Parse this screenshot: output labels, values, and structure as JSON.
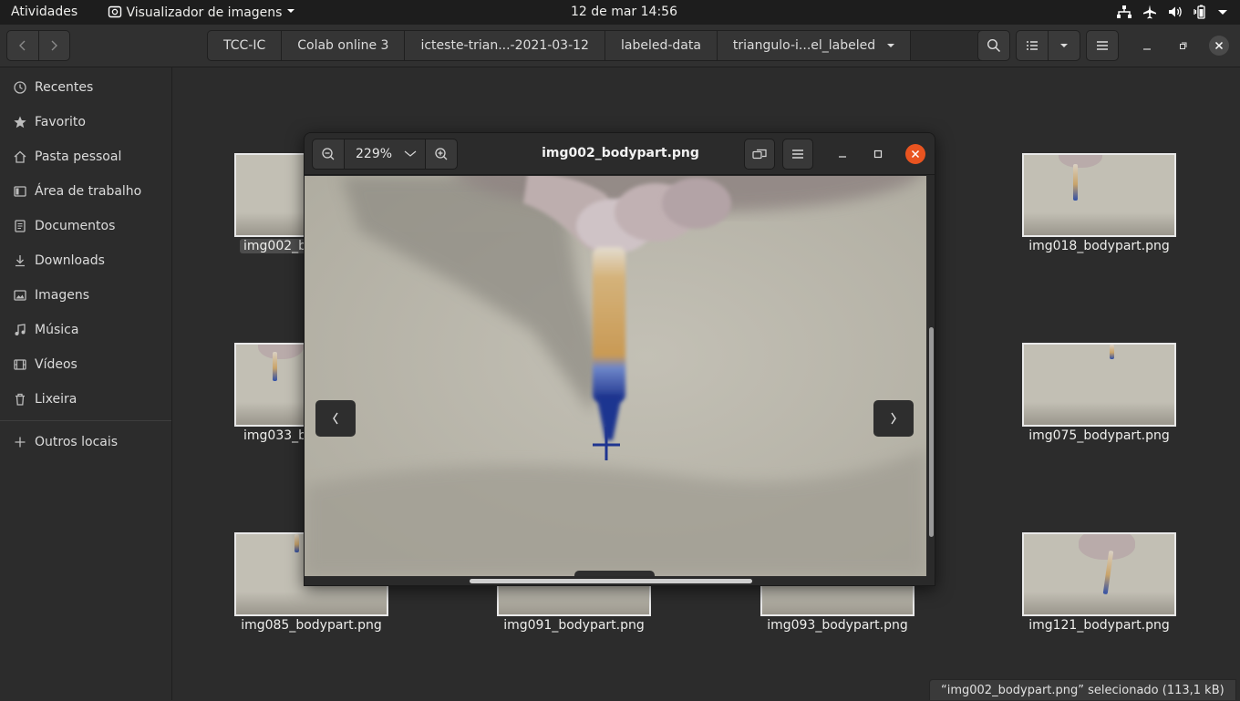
{
  "topbar": {
    "activities": "Atividades",
    "app_name": "Visualizador de imagens",
    "clock": "12 de mar  14:56"
  },
  "header": {
    "breadcrumbs": [
      "TCC-IC",
      "Colab online 3",
      "icteste-trian...-2021-03-12",
      "labeled-data",
      "triangulo-i...el_labeled"
    ]
  },
  "sidebar": {
    "items": [
      {
        "label": "Recentes",
        "icon": "clock-icon"
      },
      {
        "label": "Favorito",
        "icon": "star-icon"
      },
      {
        "label": "Pasta pessoal",
        "icon": "home-icon"
      },
      {
        "label": "Área de trabalho",
        "icon": "desktop-icon"
      },
      {
        "label": "Documentos",
        "icon": "document-icon"
      },
      {
        "label": "Downloads",
        "icon": "download-icon"
      },
      {
        "label": "Imagens",
        "icon": "image-icon"
      },
      {
        "label": "Música",
        "icon": "music-icon"
      },
      {
        "label": "Vídeos",
        "icon": "video-icon"
      },
      {
        "label": "Lixeira",
        "icon": "trash-icon"
      }
    ],
    "other": "Outros locais"
  },
  "files": [
    {
      "name": "img002_b",
      "selected": true
    },
    {
      "name": "img018_bodypart.png"
    },
    {
      "name": "img033_b"
    },
    {
      "name": "img075_bodypart.png"
    },
    {
      "name": "img085_bodypart.png"
    },
    {
      "name": "img091_bodypart.png"
    },
    {
      "name": "img093_bodypart.png"
    },
    {
      "name": "img121_bodypart.png"
    }
  ],
  "status": "“img002_bodypart.png” selecionado  (113,1 kB)",
  "viewer": {
    "zoom": "229%",
    "title": "img002_bodypart.png"
  },
  "colors": {
    "close_button": "#e95420",
    "background": "#2c2c2c"
  }
}
